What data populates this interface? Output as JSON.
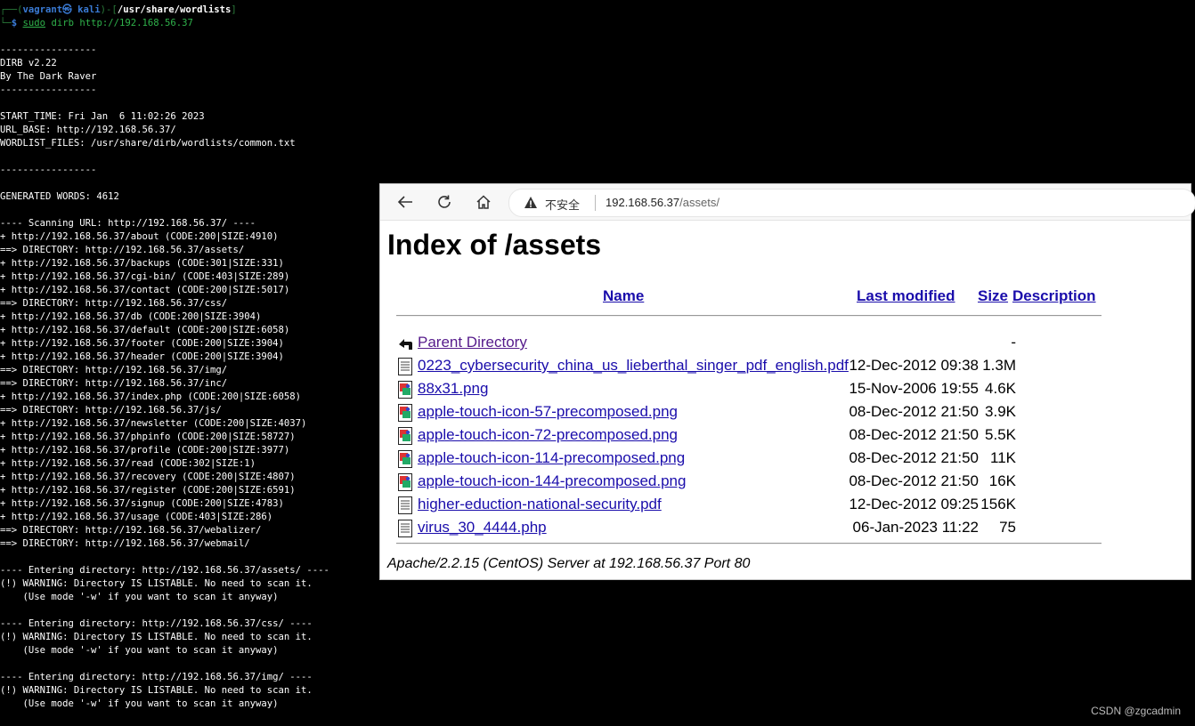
{
  "terminal": {
    "prompt": {
      "user": "vagrant",
      "at_symbol": "㉿",
      "host": "kali",
      "cwd": "/usr/share/wordlists",
      "sudo": "sudo",
      "command": "dirb http://192.168.56.37"
    },
    "lines": [
      "",
      "-----------------",
      "DIRB v2.22",
      "By The Dark Raver",
      "-----------------",
      "",
      "START_TIME: Fri Jan  6 11:02:26 2023",
      "URL_BASE: http://192.168.56.37/",
      "WORDLIST_FILES: /usr/share/dirb/wordlists/common.txt",
      "",
      "-----------------",
      "",
      "GENERATED WORDS: 4612",
      "",
      "---- Scanning URL: http://192.168.56.37/ ----",
      "+ http://192.168.56.37/about (CODE:200|SIZE:4910)",
      "==> DIRECTORY: http://192.168.56.37/assets/",
      "+ http://192.168.56.37/backups (CODE:301|SIZE:331)",
      "+ http://192.168.56.37/cgi-bin/ (CODE:403|SIZE:289)",
      "+ http://192.168.56.37/contact (CODE:200|SIZE:5017)",
      "==> DIRECTORY: http://192.168.56.37/css/",
      "+ http://192.168.56.37/db (CODE:200|SIZE:3904)",
      "+ http://192.168.56.37/default (CODE:200|SIZE:6058)",
      "+ http://192.168.56.37/footer (CODE:200|SIZE:3904)",
      "+ http://192.168.56.37/header (CODE:200|SIZE:3904)",
      "==> DIRECTORY: http://192.168.56.37/img/",
      "==> DIRECTORY: http://192.168.56.37/inc/",
      "+ http://192.168.56.37/index.php (CODE:200|SIZE:6058)",
      "==> DIRECTORY: http://192.168.56.37/js/",
      "+ http://192.168.56.37/newsletter (CODE:200|SIZE:4037)",
      "+ http://192.168.56.37/phpinfo (CODE:200|SIZE:58727)",
      "+ http://192.168.56.37/profile (CODE:200|SIZE:3977)",
      "+ http://192.168.56.37/read (CODE:302|SIZE:1)",
      "+ http://192.168.56.37/recovery (CODE:200|SIZE:4807)",
      "+ http://192.168.56.37/register (CODE:200|SIZE:6591)",
      "+ http://192.168.56.37/signup (CODE:200|SIZE:4783)",
      "+ http://192.168.56.37/usage (CODE:403|SIZE:286)",
      "==> DIRECTORY: http://192.168.56.37/webalizer/",
      "==> DIRECTORY: http://192.168.56.37/webmail/",
      "",
      "---- Entering directory: http://192.168.56.37/assets/ ----",
      "(!) WARNING: Directory IS LISTABLE. No need to scan it.",
      "    (Use mode '-w' if you want to scan it anyway)",
      "",
      "---- Entering directory: http://192.168.56.37/css/ ----",
      "(!) WARNING: Directory IS LISTABLE. No need to scan it.",
      "    (Use mode '-w' if you want to scan it anyway)",
      "",
      "---- Entering directory: http://192.168.56.37/img/ ----",
      "(!) WARNING: Directory IS LISTABLE. No need to scan it.",
      "    (Use mode '-w' if you want to scan it anyway)"
    ]
  },
  "browser": {
    "security_label": "不安全",
    "url_host": "192.168.56.37",
    "url_path": "/assets/",
    "page_title": "Index of /assets",
    "columns": {
      "name": "Name",
      "last_modified": "Last modified",
      "size": "Size",
      "description": "Description"
    },
    "entries": [
      {
        "icon": "back-icon",
        "name": "Parent Directory",
        "modified": "",
        "size": "-",
        "visited": true
      },
      {
        "icon": "document-icon",
        "name": "0223_cybersecurity_china_us_lieberthal_singer_pdf_english.pdf",
        "modified": "12-Dec-2012 09:38",
        "size": "1.3M"
      },
      {
        "icon": "image-icon",
        "name": "88x31.png",
        "modified": "15-Nov-2006 19:55",
        "size": "4.6K"
      },
      {
        "icon": "image-icon",
        "name": "apple-touch-icon-57-precomposed.png",
        "modified": "08-Dec-2012 21:50",
        "size": "3.9K"
      },
      {
        "icon": "image-icon",
        "name": "apple-touch-icon-72-precomposed.png",
        "modified": "08-Dec-2012 21:50",
        "size": "5.5K"
      },
      {
        "icon": "image-icon",
        "name": "apple-touch-icon-114-precomposed.png",
        "modified": "08-Dec-2012 21:50",
        "size": "11K"
      },
      {
        "icon": "image-icon",
        "name": "apple-touch-icon-144-precomposed.png",
        "modified": "08-Dec-2012 21:50",
        "size": "16K"
      },
      {
        "icon": "document-icon",
        "name": "higher-eduction-national-security.pdf",
        "modified": "12-Dec-2012 09:25",
        "size": "156K"
      },
      {
        "icon": "document-icon",
        "name": "virus_30_4444.php",
        "modified": "06-Jan-2023 11:22",
        "size": "75"
      }
    ],
    "server_signature": "Apache/2.2.15 (CentOS) Server at 192.168.56.37 Port 80"
  },
  "watermark": "CSDN @zgcadmin"
}
